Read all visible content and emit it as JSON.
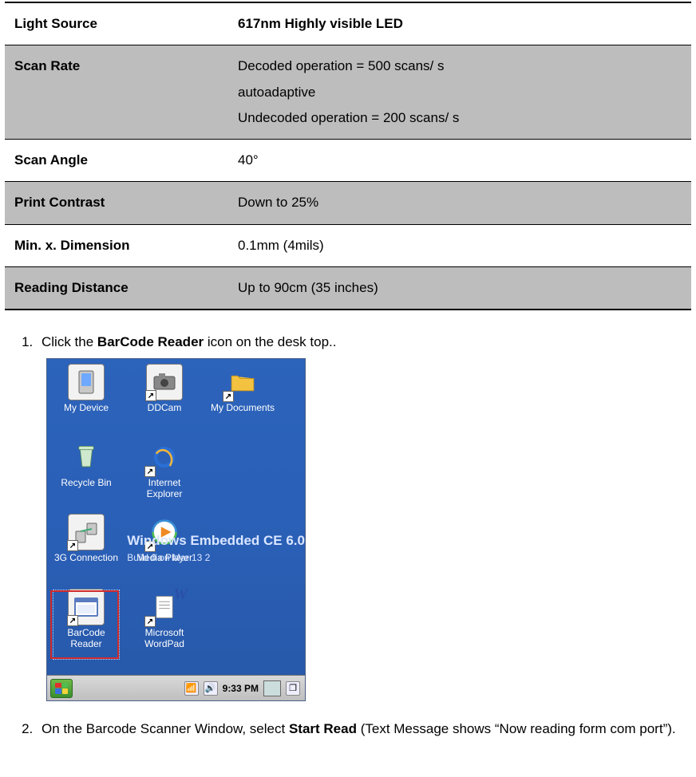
{
  "spec_table": {
    "rows": [
      {
        "label": "Light Source",
        "value": "617nm Highly visible LED",
        "value_bold": true
      },
      {
        "label": "Scan Rate",
        "value": "Decoded operation = 500 scans/ s\nautoadaptive\nUndecoded operation = 200 scans/ s"
      },
      {
        "label": "Scan Angle",
        "value": "40°"
      },
      {
        "label": "Print Contrast",
        "value": "Down to 25%"
      },
      {
        "label": "Min. x. Dimension",
        "value": "0.1mm (4mils)"
      },
      {
        "label": "Reading Distance",
        "value": "Up to 90cm (35 inches)"
      }
    ]
  },
  "steps": {
    "one_prefix": "Click the ",
    "one_bold": "BarCode Reader",
    "one_suffix": " icon on the desk top..",
    "two_prefix": "On the Barcode Scanner Window, select ",
    "two_bold": "Start Read",
    "two_suffix": " (Text Message shows “Now reading form com port”)."
  },
  "screenshot": {
    "desktop_icons": [
      {
        "name": "My Device",
        "icon": "pda-icon",
        "shortcut": false
      },
      {
        "name": "DDCam",
        "icon": "camera-icon",
        "shortcut": true
      },
      {
        "name": "My Documents",
        "icon": "folder-icon",
        "shortcut": true
      },
      {
        "name": "Recycle Bin",
        "icon": "recycle-bin-icon",
        "shortcut": false
      },
      {
        "name": "Internet Explorer",
        "icon": "ie-icon",
        "shortcut": true
      },
      {
        "name": "",
        "icon": "",
        "shortcut": false
      },
      {
        "name": "3G Connection",
        "icon": "network-icon",
        "shortcut": true
      },
      {
        "name": "Media Player",
        "icon": "media-player-icon",
        "shortcut": true
      },
      {
        "name": "",
        "icon": "",
        "shortcut": false
      },
      {
        "name": "BarCode Reader",
        "icon": "barcode-app-icon",
        "shortcut": true,
        "selected": true
      },
      {
        "name": "Microsoft WordPad",
        "icon": "wordpad-icon",
        "shortcut": true
      }
    ],
    "watermark_line1": "Windows Embedded CE 6.0",
    "watermark_line2": "Build 0 on Mar 13 2",
    "taskbar": {
      "clock": "9:33 PM",
      "tray_icons": [
        "signal-icon",
        "speaker-icon"
      ]
    }
  }
}
